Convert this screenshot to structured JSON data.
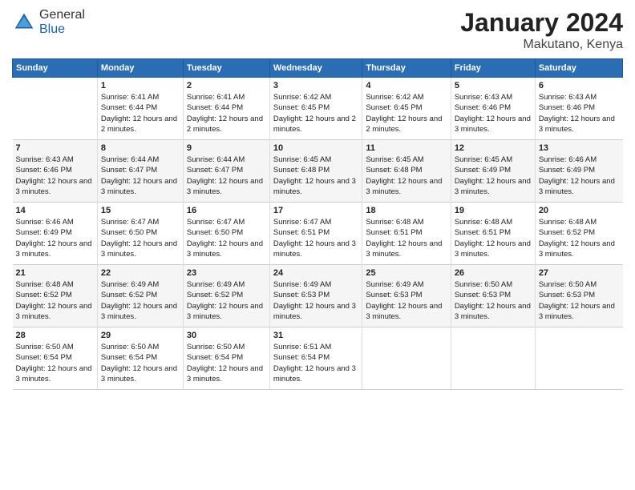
{
  "logo": {
    "general": "General",
    "blue": "Blue"
  },
  "title": "January 2024",
  "subtitle": "Makutano, Kenya",
  "days_header": [
    "Sunday",
    "Monday",
    "Tuesday",
    "Wednesday",
    "Thursday",
    "Friday",
    "Saturday"
  ],
  "weeks": [
    [
      {
        "day": "",
        "sunrise": "",
        "sunset": "",
        "daylight": ""
      },
      {
        "day": "1",
        "sunrise": "Sunrise: 6:41 AM",
        "sunset": "Sunset: 6:44 PM",
        "daylight": "Daylight: 12 hours and 2 minutes."
      },
      {
        "day": "2",
        "sunrise": "Sunrise: 6:41 AM",
        "sunset": "Sunset: 6:44 PM",
        "daylight": "Daylight: 12 hours and 2 minutes."
      },
      {
        "day": "3",
        "sunrise": "Sunrise: 6:42 AM",
        "sunset": "Sunset: 6:45 PM",
        "daylight": "Daylight: 12 hours and 2 minutes."
      },
      {
        "day": "4",
        "sunrise": "Sunrise: 6:42 AM",
        "sunset": "Sunset: 6:45 PM",
        "daylight": "Daylight: 12 hours and 2 minutes."
      },
      {
        "day": "5",
        "sunrise": "Sunrise: 6:43 AM",
        "sunset": "Sunset: 6:46 PM",
        "daylight": "Daylight: 12 hours and 3 minutes."
      },
      {
        "day": "6",
        "sunrise": "Sunrise: 6:43 AM",
        "sunset": "Sunset: 6:46 PM",
        "daylight": "Daylight: 12 hours and 3 minutes."
      }
    ],
    [
      {
        "day": "7",
        "sunrise": "Sunrise: 6:43 AM",
        "sunset": "Sunset: 6:46 PM",
        "daylight": "Daylight: 12 hours and 3 minutes."
      },
      {
        "day": "8",
        "sunrise": "Sunrise: 6:44 AM",
        "sunset": "Sunset: 6:47 PM",
        "daylight": "Daylight: 12 hours and 3 minutes."
      },
      {
        "day": "9",
        "sunrise": "Sunrise: 6:44 AM",
        "sunset": "Sunset: 6:47 PM",
        "daylight": "Daylight: 12 hours and 3 minutes."
      },
      {
        "day": "10",
        "sunrise": "Sunrise: 6:45 AM",
        "sunset": "Sunset: 6:48 PM",
        "daylight": "Daylight: 12 hours and 3 minutes."
      },
      {
        "day": "11",
        "sunrise": "Sunrise: 6:45 AM",
        "sunset": "Sunset: 6:48 PM",
        "daylight": "Daylight: 12 hours and 3 minutes."
      },
      {
        "day": "12",
        "sunrise": "Sunrise: 6:45 AM",
        "sunset": "Sunset: 6:49 PM",
        "daylight": "Daylight: 12 hours and 3 minutes."
      },
      {
        "day": "13",
        "sunrise": "Sunrise: 6:46 AM",
        "sunset": "Sunset: 6:49 PM",
        "daylight": "Daylight: 12 hours and 3 minutes."
      }
    ],
    [
      {
        "day": "14",
        "sunrise": "Sunrise: 6:46 AM",
        "sunset": "Sunset: 6:49 PM",
        "daylight": "Daylight: 12 hours and 3 minutes."
      },
      {
        "day": "15",
        "sunrise": "Sunrise: 6:47 AM",
        "sunset": "Sunset: 6:50 PM",
        "daylight": "Daylight: 12 hours and 3 minutes."
      },
      {
        "day": "16",
        "sunrise": "Sunrise: 6:47 AM",
        "sunset": "Sunset: 6:50 PM",
        "daylight": "Daylight: 12 hours and 3 minutes."
      },
      {
        "day": "17",
        "sunrise": "Sunrise: 6:47 AM",
        "sunset": "Sunset: 6:51 PM",
        "daylight": "Daylight: 12 hours and 3 minutes."
      },
      {
        "day": "18",
        "sunrise": "Sunrise: 6:48 AM",
        "sunset": "Sunset: 6:51 PM",
        "daylight": "Daylight: 12 hours and 3 minutes."
      },
      {
        "day": "19",
        "sunrise": "Sunrise: 6:48 AM",
        "sunset": "Sunset: 6:51 PM",
        "daylight": "Daylight: 12 hours and 3 minutes."
      },
      {
        "day": "20",
        "sunrise": "Sunrise: 6:48 AM",
        "sunset": "Sunset: 6:52 PM",
        "daylight": "Daylight: 12 hours and 3 minutes."
      }
    ],
    [
      {
        "day": "21",
        "sunrise": "Sunrise: 6:48 AM",
        "sunset": "Sunset: 6:52 PM",
        "daylight": "Daylight: 12 hours and 3 minutes."
      },
      {
        "day": "22",
        "sunrise": "Sunrise: 6:49 AM",
        "sunset": "Sunset: 6:52 PM",
        "daylight": "Daylight: 12 hours and 3 minutes."
      },
      {
        "day": "23",
        "sunrise": "Sunrise: 6:49 AM",
        "sunset": "Sunset: 6:52 PM",
        "daylight": "Daylight: 12 hours and 3 minutes."
      },
      {
        "day": "24",
        "sunrise": "Sunrise: 6:49 AM",
        "sunset": "Sunset: 6:53 PM",
        "daylight": "Daylight: 12 hours and 3 minutes."
      },
      {
        "day": "25",
        "sunrise": "Sunrise: 6:49 AM",
        "sunset": "Sunset: 6:53 PM",
        "daylight": "Daylight: 12 hours and 3 minutes."
      },
      {
        "day": "26",
        "sunrise": "Sunrise: 6:50 AM",
        "sunset": "Sunset: 6:53 PM",
        "daylight": "Daylight: 12 hours and 3 minutes."
      },
      {
        "day": "27",
        "sunrise": "Sunrise: 6:50 AM",
        "sunset": "Sunset: 6:53 PM",
        "daylight": "Daylight: 12 hours and 3 minutes."
      }
    ],
    [
      {
        "day": "28",
        "sunrise": "Sunrise: 6:50 AM",
        "sunset": "Sunset: 6:54 PM",
        "daylight": "Daylight: 12 hours and 3 minutes."
      },
      {
        "day": "29",
        "sunrise": "Sunrise: 6:50 AM",
        "sunset": "Sunset: 6:54 PM",
        "daylight": "Daylight: 12 hours and 3 minutes."
      },
      {
        "day": "30",
        "sunrise": "Sunrise: 6:50 AM",
        "sunset": "Sunset: 6:54 PM",
        "daylight": "Daylight: 12 hours and 3 minutes."
      },
      {
        "day": "31",
        "sunrise": "Sunrise: 6:51 AM",
        "sunset": "Sunset: 6:54 PM",
        "daylight": "Daylight: 12 hours and 3 minutes."
      },
      {
        "day": "",
        "sunrise": "",
        "sunset": "",
        "daylight": ""
      },
      {
        "day": "",
        "sunrise": "",
        "sunset": "",
        "daylight": ""
      },
      {
        "day": "",
        "sunrise": "",
        "sunset": "",
        "daylight": ""
      }
    ]
  ]
}
